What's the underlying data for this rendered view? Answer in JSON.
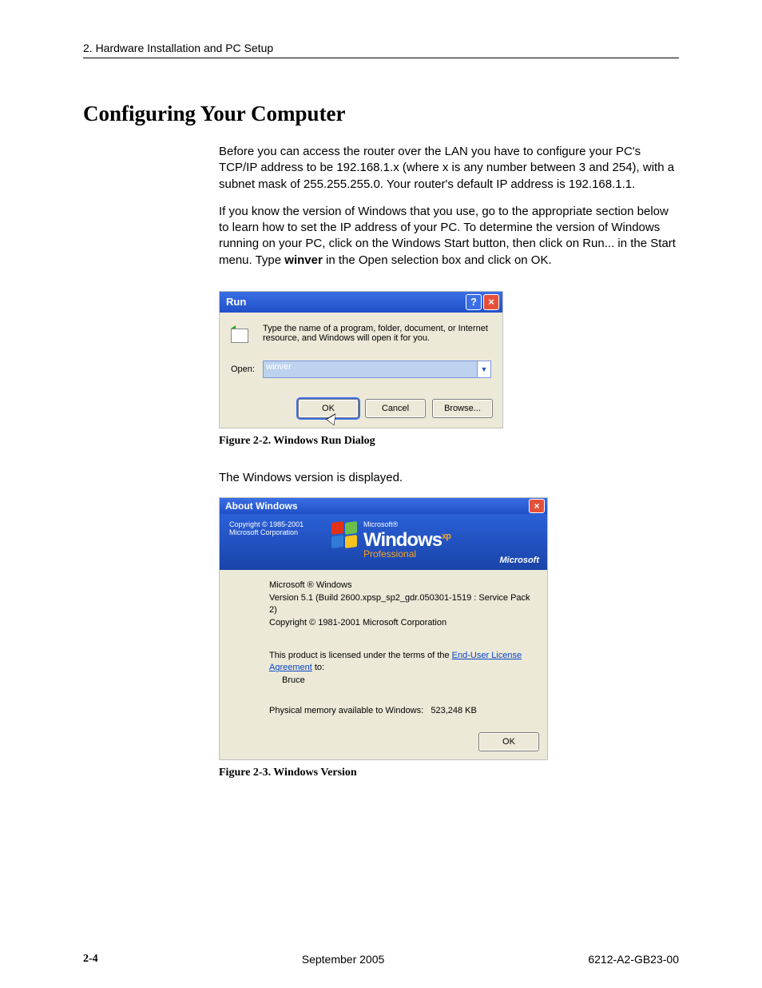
{
  "header": {
    "chapter": "2. Hardware Installation and PC Setup"
  },
  "section_title": "Configuring Your Computer",
  "paragraph1": "Before you can access the router over the LAN you have to configure your PC's TCP/IP address to be 192.168.1.x (where x is any number between 3 and 254), with a subnet mask of 255.255.255.0. Your router's default IP address is 192.168.1.1.",
  "paragraph2_a": "If you know the version of Windows that you use, go to the appropriate section below to learn how to set the IP address of your PC. To determine the version of Windows running on your PC, click on the Windows Start button, then click on Run... in the Start menu. Type ",
  "paragraph2_bold": "winver",
  "paragraph2_b": " in the Open selection box and click on OK.",
  "run_dialog": {
    "title": "Run",
    "help_text": "Type the name of a program, folder, document, or Internet resource, and Windows will open it for you.",
    "open_label": "Open:",
    "input_value": "winver",
    "buttons": {
      "ok": "OK",
      "cancel": "Cancel",
      "browse": "Browse..."
    }
  },
  "figure1_caption": "Figure 2-2.    Windows Run Dialog",
  "paragraph3": "The Windows version is displayed.",
  "about_dialog": {
    "title": "About Windows",
    "copyright_banner_line1": "Copyright © 1985-2001",
    "copyright_banner_line2": "Microsoft Corporation",
    "brand_ms": "Microsoft®",
    "brand_windows": "Windows",
    "brand_xp": "xp",
    "brand_edition": "Professional",
    "brand_logo": "Microsoft",
    "line1": "Microsoft ® Windows",
    "line2": "Version 5.1 (Build 2600.xpsp_sp2_gdr.050301-1519 : Service Pack 2)",
    "line3": "Copyright © 1981-2001 Microsoft Corporation",
    "eula_pre": "This product is licensed under the terms of the ",
    "eula_link": "End-User License Agreement",
    "eula_post": " to:",
    "licensed_to": "Bruce",
    "mem_label": "Physical memory available to Windows:",
    "mem_value": "523,248 KB",
    "ok": "OK"
  },
  "figure2_caption": "Figure 2-3.    Windows Version",
  "footer": {
    "page": "2-4",
    "date": "September 2005",
    "doc": "6212-A2-GB23-00"
  }
}
